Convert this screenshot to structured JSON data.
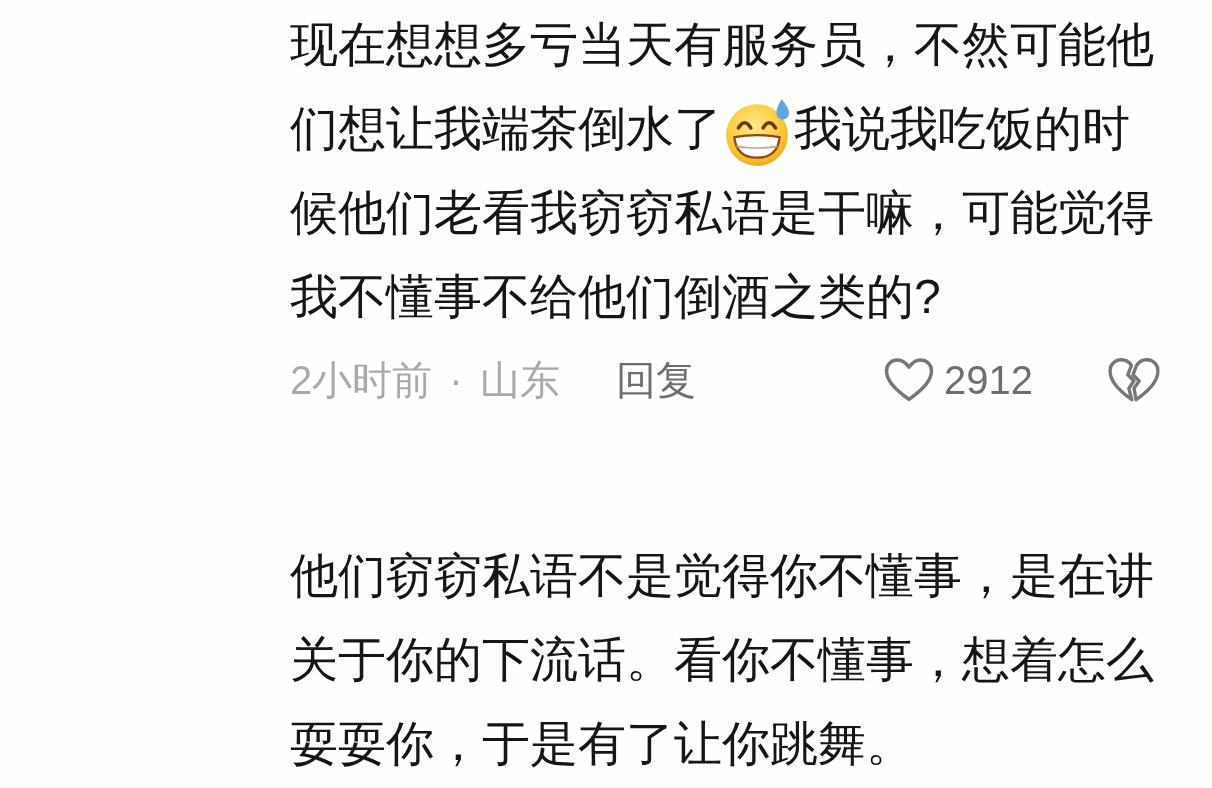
{
  "comments": [
    {
      "segments": [
        {
          "kind": "text",
          "text": "现在想想多亏当天有服务员，不然可能他们想让我端茶倒水了"
        },
        {
          "kind": "emoji"
        },
        {
          "kind": "text",
          "text": "我说我吃饭的时候他们老看我窃窃私语是干嘛，可能觉得我不懂事不给他们倒酒之类的?"
        }
      ],
      "meta": {
        "time_location": "2小时前 · 山东",
        "reply": "回复",
        "likes": "2912",
        "liked": false,
        "disliked": false
      }
    },
    {
      "segments": [
        {
          "kind": "text",
          "text": "他们窃窃私语不是觉得你不懂事，是在讲关于你的下流话。看你不懂事，想着怎么耍耍你，于是有了让你跳舞。"
        }
      ]
    }
  ]
}
